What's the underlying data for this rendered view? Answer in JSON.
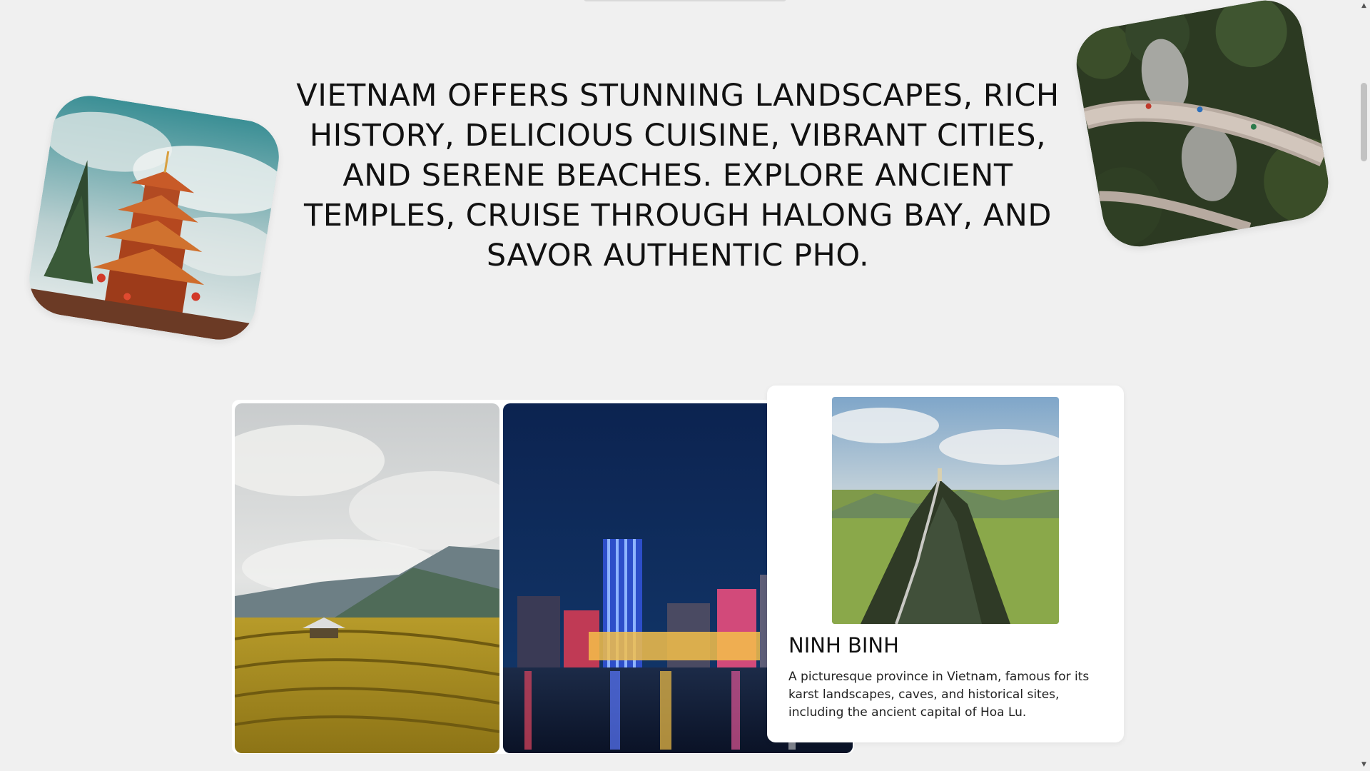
{
  "hero": {
    "text": "VIETNAM OFFERS STUNNING LANDSCAPES, RICH HISTORY, DELICIOUS CUISINE, VIBRANT CITIES, AND SERENE BEACHES. EXPLORE ANCIENT TEMPLES, CRUISE THROUGH HALONG BAY, AND SAVOR AUTHENTIC PHO."
  },
  "featured": {
    "title": "NINH BINH",
    "description": "A picturesque province in Vietnam, famous for its karst landscapes, caves, and historical sites, including the ancient capital of Hoa Lu."
  },
  "scrollbar": {
    "up_icon": "triangle-up-icon",
    "down_icon": "triangle-down-icon",
    "up_glyph": "▲",
    "down_glyph": "▼"
  },
  "colors": {
    "page_background": "#f0f0f0",
    "card_background": "#ffffff",
    "text": "#111111"
  }
}
